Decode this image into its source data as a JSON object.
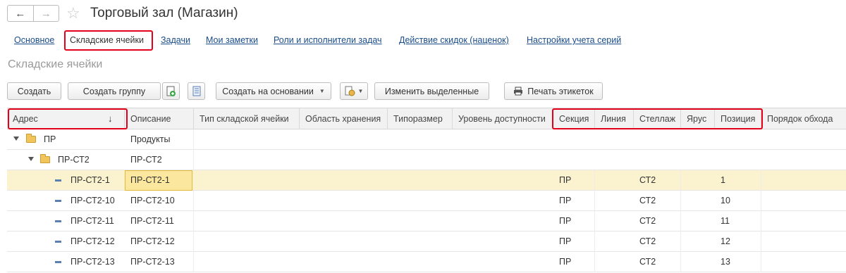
{
  "window": {
    "title": "Торговый зал (Магазин)",
    "back_icon": "←",
    "forward_icon": "→",
    "favorite_icon": "☆"
  },
  "tabs": [
    {
      "label": "Основное",
      "active": false
    },
    {
      "label": "Складские ячейки",
      "active": true
    },
    {
      "label": "Задачи",
      "active": false
    },
    {
      "label": "Мои заметки",
      "active": false
    },
    {
      "label": "Роли и исполнители задач",
      "active": false
    },
    {
      "label": "Действие скидок (наценок)",
      "active": false
    },
    {
      "label": "Настройки учета серий",
      "active": false
    }
  ],
  "section_title": "Складские ячейки",
  "toolbar": {
    "create": "Создать",
    "create_group": "Создать группу",
    "create_based_on": "Создать на основании",
    "change_selected": "Изменить выделенные",
    "print_labels": "Печать этикеток"
  },
  "grid": {
    "sort_indicator": "↓",
    "columns": [
      "Адрес",
      "Описание",
      "Тип складской ячейки",
      "Область хранения",
      "Типоразмер",
      "Уровень доступности",
      "Секция",
      "Линия",
      "Стеллаж",
      "Ярус",
      "Позиция",
      "Порядок обхода"
    ],
    "rows": [
      {
        "address": "ПР",
        "description": "Продукты",
        "section": "",
        "line": "",
        "rack": "",
        "tier": "",
        "position": "",
        "type": "group",
        "level": 0,
        "expanded": true,
        "selected": false
      },
      {
        "address": "ПР-СТ2",
        "description": "ПР-СТ2",
        "section": "",
        "line": "",
        "rack": "",
        "tier": "",
        "position": "",
        "type": "group",
        "level": 1,
        "expanded": true,
        "selected": false
      },
      {
        "address": "ПР-СТ2-1",
        "description": "ПР-СТ2-1",
        "section": "ПР",
        "line": "",
        "rack": "СТ2",
        "tier": "",
        "position": "1",
        "type": "item",
        "level": 2,
        "selected": true
      },
      {
        "address": "ПР-СТ2-10",
        "description": "ПР-СТ2-10",
        "section": "ПР",
        "line": "",
        "rack": "СТ2",
        "tier": "",
        "position": "10",
        "type": "item",
        "level": 2,
        "selected": false
      },
      {
        "address": "ПР-СТ2-11",
        "description": "ПР-СТ2-11",
        "section": "ПР",
        "line": "",
        "rack": "СТ2",
        "tier": "",
        "position": "11",
        "type": "item",
        "level": 2,
        "selected": false
      },
      {
        "address": "ПР-СТ2-12",
        "description": "ПР-СТ2-12",
        "section": "ПР",
        "line": "",
        "rack": "СТ2",
        "tier": "",
        "position": "12",
        "type": "item",
        "level": 2,
        "selected": false
      },
      {
        "address": "ПР-СТ2-13",
        "description": "ПР-СТ2-13",
        "section": "ПР",
        "line": "",
        "rack": "СТ2",
        "tier": "",
        "position": "13",
        "type": "item",
        "level": 2,
        "selected": false
      }
    ]
  }
}
